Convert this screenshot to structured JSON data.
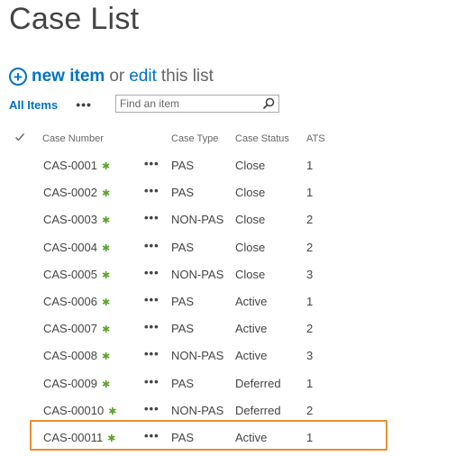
{
  "page": {
    "title": "Case List"
  },
  "command_bar": {
    "new_item": "new item",
    "or": "or",
    "edit": "edit",
    "this_list": "this list"
  },
  "views": {
    "current": "All Items",
    "more": "•••",
    "search_placeholder": "Find an item"
  },
  "columns": {
    "case_number": "Case Number",
    "case_type": "Case Type",
    "case_status": "Case Status",
    "ats": "ATS"
  },
  "rows": [
    {
      "case_number": "CAS-0001",
      "case_type": "PAS",
      "case_status": "Close",
      "ats": "1"
    },
    {
      "case_number": "CAS-0002",
      "case_type": "PAS",
      "case_status": "Close",
      "ats": "1"
    },
    {
      "case_number": "CAS-0003",
      "case_type": "NON-PAS",
      "case_status": "Close",
      "ats": "2"
    },
    {
      "case_number": "CAS-0004",
      "case_type": "PAS",
      "case_status": "Close",
      "ats": "2"
    },
    {
      "case_number": "CAS-0005",
      "case_type": "NON-PAS",
      "case_status": "Close",
      "ats": "3"
    },
    {
      "case_number": "CAS-0006",
      "case_type": "PAS",
      "case_status": "Active",
      "ats": "1"
    },
    {
      "case_number": "CAS-0007",
      "case_type": "PAS",
      "case_status": "Active",
      "ats": "2"
    },
    {
      "case_number": "CAS-0008",
      "case_type": "NON-PAS",
      "case_status": "Active",
      "ats": "3"
    },
    {
      "case_number": "CAS-0009",
      "case_type": "PAS",
      "case_status": "Deferred",
      "ats": "1"
    },
    {
      "case_number": "CAS-00010",
      "case_type": "NON-PAS",
      "case_status": "Deferred",
      "ats": "2"
    },
    {
      "case_number": "CAS-00011",
      "case_type": "PAS",
      "case_status": "Active",
      "ats": "1"
    }
  ],
  "icons": {
    "new_badge": "new-sparkle-icon",
    "row_menu": "•••",
    "add": "+"
  },
  "colors": {
    "link_blue": "#0072c6",
    "new_green": "#5ba52a",
    "highlight_orange": "#e8902f"
  }
}
